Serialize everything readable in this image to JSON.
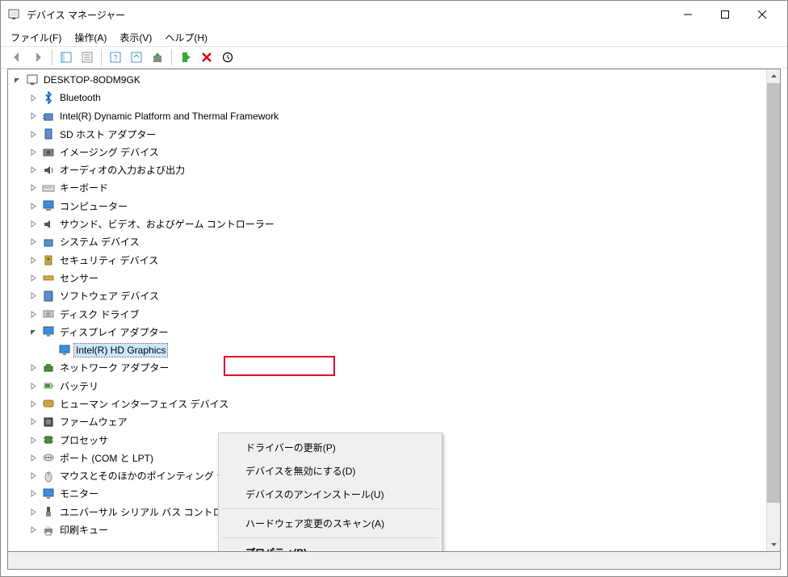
{
  "window": {
    "title": "デバイス マネージャー"
  },
  "menu": {
    "file": "ファイル(F)",
    "action": "操作(A)",
    "view": "表示(V)",
    "help": "ヘルプ(H)"
  },
  "tree": {
    "root": "DESKTOP-8ODM9GK",
    "items": [
      {
        "label": "Bluetooth",
        "icon": "bluetooth"
      },
      {
        "label": "Intel(R) Dynamic Platform and Thermal Framework",
        "icon": "thermal"
      },
      {
        "label": "SD ホスト アダプター",
        "icon": "sd"
      },
      {
        "label": "イメージング デバイス",
        "icon": "imaging"
      },
      {
        "label": "オーディオの入力および出力",
        "icon": "audio"
      },
      {
        "label": "キーボード",
        "icon": "keyboard"
      },
      {
        "label": "コンピューター",
        "icon": "computer"
      },
      {
        "label": "サウンド、ビデオ、およびゲーム コントローラー",
        "icon": "sound"
      },
      {
        "label": "システム デバイス",
        "icon": "system"
      },
      {
        "label": "セキュリティ デバイス",
        "icon": "security"
      },
      {
        "label": "センサー",
        "icon": "sensor"
      },
      {
        "label": "ソフトウェア デバイス",
        "icon": "software"
      },
      {
        "label": "ディスク ドライブ",
        "icon": "disk"
      },
      {
        "label": "ディスプレイ アダプター",
        "icon": "display",
        "expanded": true,
        "children": [
          {
            "label": "Intel(R) HD Graphics",
            "icon": "display",
            "selected": true
          }
        ]
      },
      {
        "label": "ネットワーク アダプター",
        "icon": "network"
      },
      {
        "label": "バッテリ",
        "icon": "battery"
      },
      {
        "label": "ヒューマン インターフェイス デバイス",
        "icon": "hid"
      },
      {
        "label": "ファームウェア",
        "icon": "firmware"
      },
      {
        "label": "プロセッサ",
        "icon": "cpu"
      },
      {
        "label": "ポート (COM と LPT)",
        "icon": "port"
      },
      {
        "label": "マウスとそのほかのポインティング デバイス",
        "icon": "mouse"
      },
      {
        "label": "モニター",
        "icon": "monitor"
      },
      {
        "label": "ユニバーサル シリアル バス コントローラー",
        "icon": "usb"
      },
      {
        "label": "印刷キュー",
        "icon": "printer"
      }
    ]
  },
  "context_menu": {
    "update_driver": "ドライバーの更新(P)",
    "disable_device": "デバイスを無効にする(D)",
    "uninstall_device": "デバイスのアンインストール(U)",
    "scan_hardware": "ハードウェア変更のスキャン(A)",
    "properties": "プロパティ(R)"
  }
}
